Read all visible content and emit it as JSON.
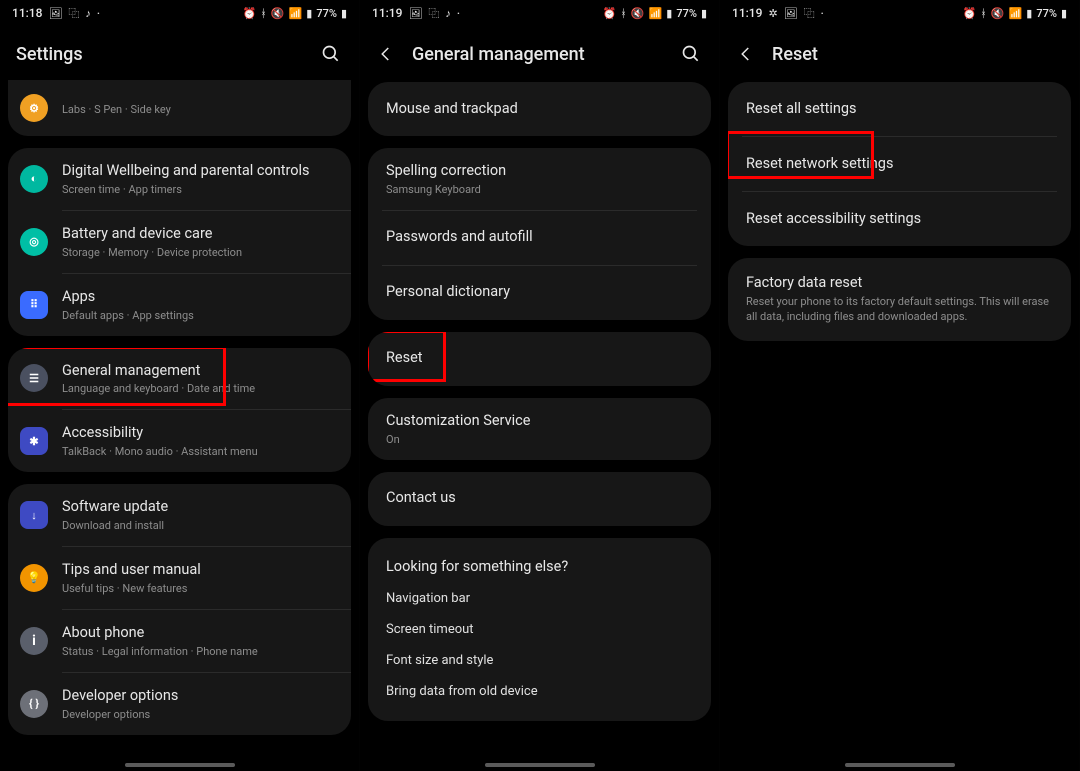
{
  "status": {
    "time1": "11:18",
    "time2": "11:19",
    "time3": "11:19",
    "battery": "77%"
  },
  "screen1": {
    "title": "Settings",
    "partial_item": {
      "title": "",
      "subtitle": "Labs  ·  S Pen  ·  Side key"
    },
    "group1": [
      {
        "title": "Digital Wellbeing and parental controls",
        "subtitle": "Screen time  ·  App timers",
        "icon": "wellbeing",
        "color": "ic-teal"
      },
      {
        "title": "Battery and device care",
        "subtitle": "Storage  ·  Memory  ·  Device protection",
        "icon": "battery-care",
        "color": "ic-teal2"
      },
      {
        "title": "Apps",
        "subtitle": "Default apps  ·  App settings",
        "icon": "apps",
        "color": "ic-blue"
      }
    ],
    "group2": [
      {
        "title": "General management",
        "subtitle": "Language and keyboard  ·  Date and time",
        "icon": "sliders",
        "color": "ic-grey"
      },
      {
        "title": "Accessibility",
        "subtitle": "TalkBack  ·  Mono audio  ·  Assistant menu",
        "icon": "accessibility",
        "color": "ic-darkblue"
      }
    ],
    "group3": [
      {
        "title": "Software update",
        "subtitle": "Download and install",
        "icon": "download",
        "color": "ic-darkblue"
      },
      {
        "title": "Tips and user manual",
        "subtitle": "Useful tips  ·  New features",
        "icon": "bulb",
        "color": "ic-orange2"
      },
      {
        "title": "About phone",
        "subtitle": "Status  ·  Legal information  ·  Phone name",
        "icon": "info",
        "color": "ic-grey2"
      },
      {
        "title": "Developer options",
        "subtitle": "Developer options",
        "icon": "braces",
        "color": "ic-grey3"
      }
    ]
  },
  "screen2": {
    "title": "General management",
    "group1": [
      {
        "title": "Mouse and trackpad"
      }
    ],
    "group2": [
      {
        "title": "Spelling correction",
        "subtitle": "Samsung Keyboard"
      },
      {
        "title": "Passwords and autofill"
      },
      {
        "title": "Personal dictionary"
      }
    ],
    "group3": [
      {
        "title": "Reset"
      }
    ],
    "group4": [
      {
        "title": "Customization Service",
        "subtitle": "On"
      }
    ],
    "group5": [
      {
        "title": "Contact us"
      }
    ],
    "looking_heading": "Looking for something else?",
    "links": [
      "Navigation bar",
      "Screen timeout",
      "Font size and style",
      "Bring data from old device"
    ]
  },
  "screen3": {
    "title": "Reset",
    "group1": [
      {
        "title": "Reset all settings"
      },
      {
        "title": "Reset network settings"
      },
      {
        "title": "Reset accessibility settings"
      }
    ],
    "group2": [
      {
        "title": "Factory data reset",
        "subtitle": "Reset your phone to its factory default settings. This will erase all data, including files and downloaded apps."
      }
    ]
  }
}
